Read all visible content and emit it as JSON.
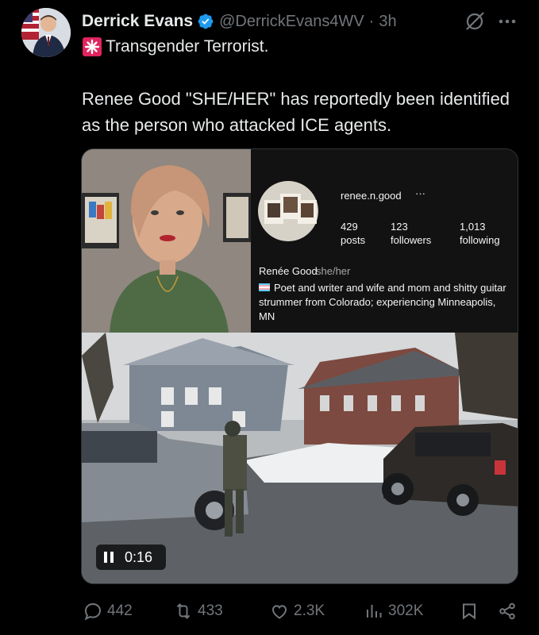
{
  "post": {
    "author_name": "Derrick Evans",
    "handle": "@DerrickEvans4WV",
    "separator": "·",
    "time": "3h",
    "headline_text": "Transgender Terrorist.",
    "body": "Renee Good \"SHE/HER\" has reportedly been identified as the person who attacked ICE agents."
  },
  "profile_card": {
    "username": "renee.n.good",
    "more": "···",
    "stats": [
      {
        "value": "429",
        "label": "posts"
      },
      {
        "value": "123",
        "label": "followers"
      },
      {
        "value": "1,013",
        "label": "following"
      }
    ],
    "display_name": "Renée Good",
    "pronouns": "she/her",
    "bio": "Poet and writer and wife and mom and shitty guitar strummer from Colorado; experiencing Minneapolis, MN"
  },
  "video": {
    "timecode": "0:16"
  },
  "actions": {
    "replies": "442",
    "reposts": "433",
    "likes": "2.3K",
    "views": "302K"
  },
  "colors": {
    "background": "#000000",
    "text": "#e7e9ea",
    "muted": "#71767b",
    "verified": "#1d9bf0"
  },
  "icons": [
    "verified-badge-icon",
    "grok-icon",
    "more-icon",
    "siren-icon",
    "pause-icon",
    "reply-icon",
    "repost-icon",
    "like-icon",
    "views-icon",
    "bookmark-icon",
    "share-icon"
  ]
}
